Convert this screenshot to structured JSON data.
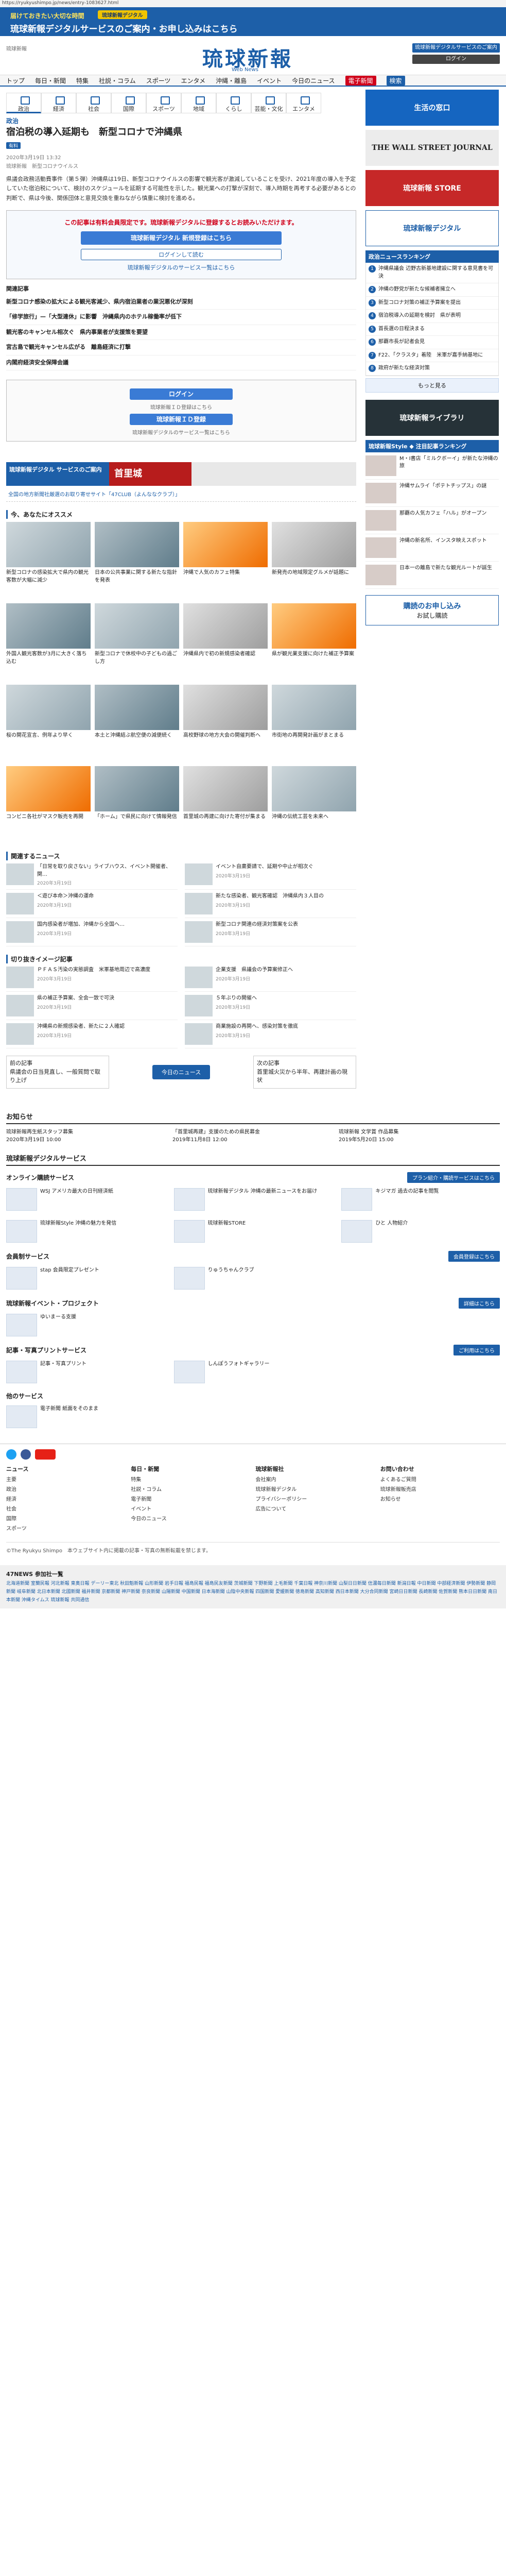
{
  "url": "https://ryukyushimpo.jp/news/entry-1083627.html",
  "top_banner": {
    "line1": "届けておきたい大切な時間",
    "pill": "琉球新報デジタル",
    "line2": "琉球新報デジタルサービスのご案内・お申し込みはこちら"
  },
  "header": {
    "left": "琉球新報",
    "logo": "琉球新報",
    "logo_sub": "Web News",
    "btn1": "琉球新報デジタルサービスのご案内",
    "btn2": "ログイン"
  },
  "nav": [
    "トップ",
    "毎日・新聞",
    "特集",
    "社説・コラム",
    "スポーツ",
    "エンタメ",
    "沖縄・離島",
    "イベント",
    "今日のニュース"
  ],
  "nav_red": "電子新聞",
  "nav_blue": "検索",
  "cat_tabs": [
    "政治",
    "経済",
    "社会",
    "国際",
    "スポーツ",
    "地域",
    "くらし",
    "芸能・文化",
    "エンタメ"
  ],
  "article": {
    "section": "政治",
    "headline": "宿泊税の導入延期も　新型コロナで沖縄県",
    "badge": "有料",
    "date": "2020年3月19日 13:32",
    "meta": "琉球新報　新型コロナウイルス",
    "body": "県議会政務活動費事件（第５弾）沖縄県は19日、新型コロナウイルスの影響で観光客が激減していることを受け、2021年度の導入を予定していた宿泊税について、検討のスケジュールを延期する可能性を示した。観光業への打撃が深刻で、導入時期を再考する必要があるとの判断で、県は今後、関係団体と意見交換を重ねながら慎重に検討を進める。",
    "paywall_title": "この記事は有料会員限定です。琉球新報デジタルに登録するとお読みいただけます。",
    "paywall_btn": "琉球新報デジタル 新規登録はこちら",
    "paywall_btn2": "ログインして読む",
    "paywall_link": "琉球新報デジタルのサービス一覧はこちら"
  },
  "related_head": "関連記事",
  "related": [
    "新型コロナ感染の拡大による観光客減少、県内宿泊業者の業況悪化が深刻",
    "「修学旅行」—「大型連休」に影響　沖縄県内のホテル稼働率が低下",
    "観光客のキャンセル相次ぐ　県内事業者が支援策を要望",
    "宮古島で観光キャンセル広がる　離島経済に打撃",
    "内閣府経済安全保障会議"
  ],
  "login": {
    "btn": "ログイン",
    "sub": "琉球新報ＩＤ登録はこちら",
    "btn2": "琉球新報ＩＤ登録",
    "link": "琉球新報デジタルのサービス一覧はこちら"
  },
  "ad": {
    "a": "琉球新報デジタル サービスのご案内",
    "b": "首里城"
  },
  "promo": "全国の地方新聞社厳選のお取り寄せサイト「47CLUB（よんななクラブ）」",
  "recommend_head": "今、あなたにオススメ",
  "grid": [
    "新型コロナの感染拡大で県内の観光客数が大幅に減少",
    "日本の公共事業に関する新たな指針を発表",
    "沖縄で人気のカフェ特集",
    "新発売の地域限定グルメが話題に",
    "外国人観光客数が3月に大きく落ち込む",
    "新型コロナで休校中の子どもの過ごし方",
    "沖縄県内で初の新規感染者確認",
    "県が観光業支援に向けた補正予算案",
    "桜の開花宣言、例年より早く",
    "本土と沖縄結ぶ航空便の減便続く",
    "高校野球の地方大会の開催判断へ",
    "市街地の再開発計画がまとまる",
    "コンビニ各社がマスク販売を再開",
    "「ホーム」で県民に向けて情報発信",
    "首里城の再建に向けた寄付が集まる",
    "沖縄の伝統工芸を未来へ"
  ],
  "rec_head": "関連するニュース",
  "recs": [
    {
      "t": "「日常を取り戻さない」ライブハウス、イベント開催者、関…",
      "d": "2020年3月19日"
    },
    {
      "t": "イベント自粛要請で、延期や中止が相次ぐ",
      "d": "2020年3月19日"
    },
    {
      "t": "＜遊び本命＞沖縄の運命",
      "d": "2020年3月19日"
    },
    {
      "t": "新たな感染者、観光客確認　沖縄県内３人目の",
      "d": "2020年3月19日"
    },
    {
      "t": "国内感染者が増加、沖縄から全国へ…",
      "d": "2020年3月19日"
    },
    {
      "t": "新型コロナ関連の経済対策案を公表",
      "d": "2020年3月19日"
    }
  ],
  "rec2_head": "切り抜きイメージ記事",
  "recs2": [
    {
      "t": "ＰＦＡＳ汚染の実態調査　米軍基地周辺で高濃度",
      "d": "2020年3月19日"
    },
    {
      "t": "企業支援　県議会の予算案修正へ",
      "d": "2020年3月19日"
    },
    {
      "t": "県の補正予算案、全会一致で可決",
      "d": "2020年3月19日"
    },
    {
      "t": "５年ぶりの開催へ",
      "d": "2020年3月19日"
    },
    {
      "t": "沖縄県の新規感染者、新たに２人確認",
      "d": "2020年3月19日"
    },
    {
      "t": "商業施設の再開へ、感染対策を徹底",
      "d": "2020年3月19日"
    }
  ],
  "pager": {
    "prev": "前の記事",
    "prev_t": "県議会の日当見直し、一般質問で取り上げ",
    "today": "今日のニュース",
    "next": "次の記事",
    "next_t": "首里城火災から半年、再建計画の現状"
  },
  "side": {
    "banner1": "生活の窓口",
    "banner2": "THE WALL STREET JOURNAL",
    "banner3": "琉球新報 STORE",
    "banner4": "琉球新報デジタル",
    "rank_head": "政治ニュースランキング",
    "ranks": [
      "沖縄県議会 辺野古新基地建設に関する意見書を可決",
      "沖縄の野党が新たな候補者擁立へ",
      "新型コロナ対策の補正予算案を提出",
      "宿泊税導入の延期を検討　県が表明",
      "首長選の日程決まる",
      "那覇市長が記者会見",
      "F22、「クラスタ」着陸　米軍が嘉手納基地に",
      "政府が新たな経済対策"
    ],
    "more": "もっと見る",
    "library_head": "琉球新報ライブラリ",
    "style_head": "琉球新報Style ◆ 注目記事ランキング",
    "style": [
      "M・I書店「ミルクボーイ」が新たな沖縄の旅",
      "沖縄サムライ「ポテトチップス」の謎",
      "那覇の人気カフェ「ハル」がオープン",
      "沖縄の新名所、インスタ映えスポット",
      "日本一の離島で新たな観光ルートが誕生"
    ],
    "subscribe": "購読のお申し込み",
    "subscribe_sub": "お試し購読"
  },
  "notice": {
    "head": "お知らせ",
    "items": [
      {
        "t": "琉球新報再生紙スタッフ募集",
        "d": "2020年3月19日 10:00"
      },
      {
        "t": "「首里城再建」支援のための県民募金",
        "d": "2019年11月8日 12:00"
      },
      {
        "t": "琉球新報 文学賞 作品募集",
        "d": "2019年5月20日 15:00"
      }
    ]
  },
  "services": {
    "head": "琉球新報デジタルサービス",
    "bars": [
      {
        "t": "オンライン購読サービス",
        "b": "プラン紹介・購読サービスはこちら"
      },
      {
        "t": "会員制サービス",
        "b": "会員登録はこちら"
      },
      {
        "t": "琉球新報イベント・プロジェクト",
        "b": "詳細はこちら"
      },
      {
        "t": "記事・写真プリントサービス",
        "b": "ご利用はこちら"
      },
      {
        "t": "他のサービス",
        "b": ""
      }
    ],
    "items": [
      "WSJ アメリカ最大の日刊経済紙",
      "琉球新報デジタル 沖縄の最新ニュースをお届け",
      "キジマガ 過去の記事を閲覧",
      "琉球新報Style 沖縄の魅力を発信",
      "琉球新報STORE",
      "ひと 人物紹介",
      "stap 会員限定プレゼント",
      "りゅうちゃんクラブ",
      "ゆいまーる支援",
      "記事・写真プリント",
      "しんぽうフォトギャラリー",
      "電子新聞 紙面をそのまま"
    ]
  },
  "footer": {
    "cols": [
      {
        "h": "ニュース",
        "items": [
          "主要",
          "政治",
          "経済",
          "社会",
          "国際",
          "スポーツ"
        ]
      },
      {
        "h": "毎日・新聞",
        "items": [
          "特集",
          "社説・コラム",
          "電子新聞",
          "イベント",
          "今日のニュース"
        ]
      },
      {
        "h": "琉球新報社",
        "items": [
          "会社案内",
          "琉球新報デジタル",
          "プライバシーポリシー",
          "広告について"
        ]
      },
      {
        "h": "お問い合わせ",
        "items": [
          "よくあるご質問",
          "琉球新報販売店",
          "お知らせ"
        ]
      }
    ],
    "copyright": "©The Ryukyu Shimpo　本ウェブサイト内に掲載の記事・写真の無断転載を禁じます。",
    "news47_title": "47NEWS 参加社一覧",
    "news47": "北海道新聞 室蘭民報 河北新報 東奥日報 デーリー東北 秋田魁新報 山形新聞 岩手日報 福島民報 福島民友新聞 茨城新聞 下野新聞 上毛新聞 千葉日報 神奈川新聞 山梨日日新聞 信濃毎日新聞 新潟日報 中日新聞 中部経済新聞 伊勢新聞 静岡新聞 岐阜新聞 北日本新聞 北國新聞 福井新聞 京都新聞 神戸新聞 奈良新聞 山陽新聞 中国新聞 日本海新聞 山陰中央新報 四国新聞 愛媛新聞 徳島新聞 高知新聞 西日本新聞 大分合同新聞 宮崎日日新聞 長崎新聞 佐賀新聞 熊本日日新聞 南日本新聞 沖縄タイムス 琉球新報 共同通信"
  }
}
